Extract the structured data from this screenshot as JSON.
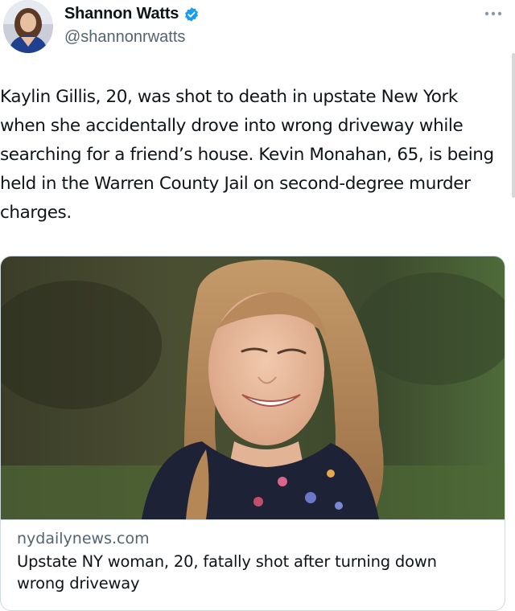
{
  "author": {
    "display_name": "Shannon Watts",
    "handle": "@shannonrwatts",
    "verified": true,
    "avatar_icon": "avatar-icon",
    "verified_icon": "verified-badge-icon"
  },
  "menu": {
    "icon": "more-icon"
  },
  "tweet": {
    "text": "Kaylin Gillis, 20, was shot to death in upstate New York when she accidentally drove into wrong driveway while searching for a friend’s house. Kevin Monahan, 65, is being held in the Warren County Jail on second-degree murder charges."
  },
  "link_card": {
    "domain": "nydailynews.com",
    "title": "Upstate NY woman, 20, fatally shot after turning down wrong driveway"
  },
  "colors": {
    "verified_blue": "#1d9bf0",
    "secondary_text": "#536471",
    "border": "#cfd9de"
  }
}
